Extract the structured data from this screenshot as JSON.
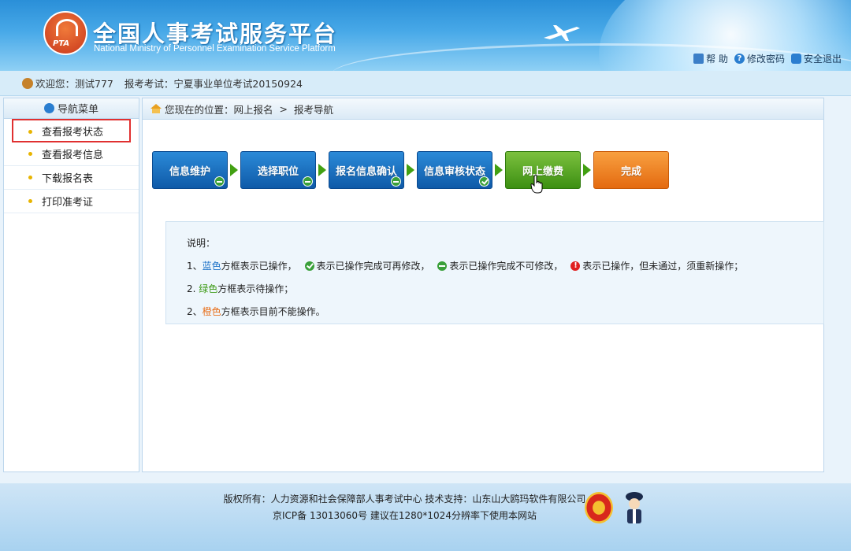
{
  "header": {
    "title": "全国人事考试服务平台",
    "subtitle": "National Ministry of Personnel Examination Service Platform",
    "logo_text": "PTA",
    "links": {
      "help": "帮 助",
      "change_password": "修改密码",
      "logout": "安全退出"
    }
  },
  "userbar": {
    "welcome": "欢迎您：测试777",
    "exam": "报考考试：宁夏事业单位考试20150924"
  },
  "sidebar": {
    "title": "导航菜单",
    "items": [
      {
        "label": "查看报考状态"
      },
      {
        "label": "查看报考信息"
      },
      {
        "label": "下载报名表"
      },
      {
        "label": "打印准考证"
      }
    ]
  },
  "breadcrumb": {
    "prefix": "您现在的位置：网上报名",
    "separator": ">",
    "current": "报考导航"
  },
  "steps": [
    {
      "label": "信息维护",
      "color": "blue",
      "badge": "minus"
    },
    {
      "label": "选择职位",
      "color": "blue",
      "badge": "minus"
    },
    {
      "label": "报名信息确认",
      "color": "blue",
      "badge": "minus"
    },
    {
      "label": "信息审核状态",
      "color": "blue",
      "badge": "check"
    },
    {
      "label": "网上缴费",
      "color": "green",
      "badge": ""
    },
    {
      "label": "完成",
      "color": "orange",
      "badge": ""
    }
  ],
  "notes": {
    "title": "说明：",
    "line1_prefix": "1、",
    "line1_blue": "蓝色",
    "line1_text": "方框表示已操作，",
    "line1_check": "表示已操作完成可再修改，",
    "line1_minus": "表示已操作完成不可修改，",
    "line1_excl": "表示已操作，但未通过，须重新操作；",
    "line2_prefix": "2. ",
    "line2_green": "绿色",
    "line2_text": "方框表示待操作；",
    "line3_prefix": "2、",
    "line3_orange": "橙色",
    "line3_text": "方框表示目前不能操作。"
  },
  "footer": {
    "line1": "版权所有：人力资源和社会保障部人事考试中心  技术支持：山东山大鸥玛软件有限公司",
    "line2": "京ICP备 13013060号  建议在1280*1024分辨率下使用本网站"
  },
  "colors": {
    "step_blue": "#1a6fc0",
    "step_green": "#5aaa24",
    "step_orange": "#f08428",
    "active_border": "#e03030"
  }
}
